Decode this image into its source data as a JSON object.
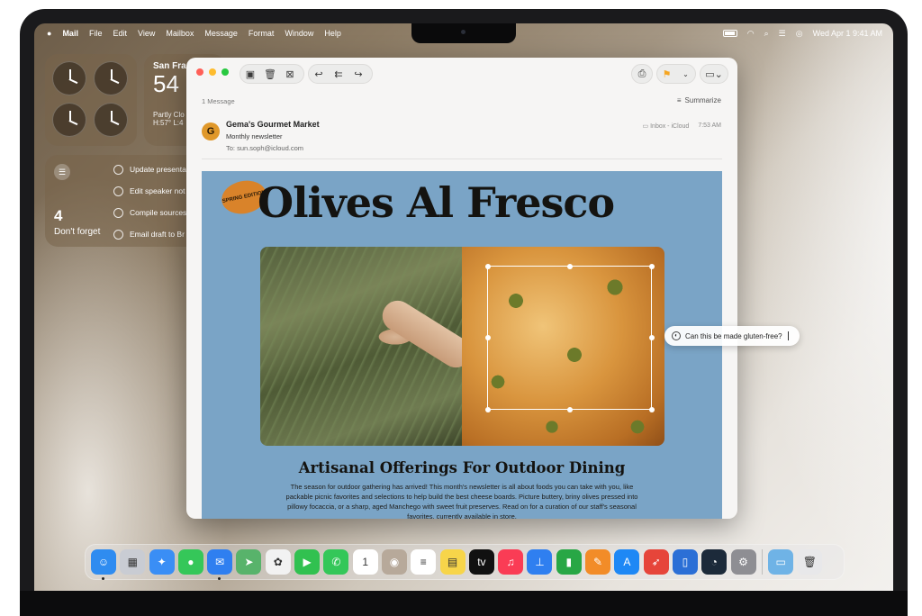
{
  "menubar": {
    "apple": "",
    "app_name": "Mail",
    "menus": [
      "File",
      "Edit",
      "View",
      "Mailbox",
      "Message",
      "Format",
      "Window",
      "Help"
    ],
    "datetime": "Wed Apr 1  9:41 AM"
  },
  "widgets": {
    "weather": {
      "city": "San Fra",
      "temp": "54",
      "condition": "Partly Clo",
      "hilo": "H:57° L:4"
    },
    "reminders": {
      "count": "4",
      "label": "Don't forget",
      "items": [
        "Update presenta",
        "Edit speaker not",
        "Compile sources",
        "Email draft to Br"
      ]
    }
  },
  "mail": {
    "message_count": "1 Message",
    "summarize_label": "Summarize",
    "sender_initial": "G",
    "sender": "Gema's Gourmet Market",
    "subject": "Monthly newsletter",
    "to_label": "To:",
    "to_address": "sun.soph@icloud.com",
    "mailbox": "Inbox - iCloud",
    "time": "7:53 AM"
  },
  "newsletter": {
    "badge": "SPRING EDITION",
    "headline": "Olives Al Fresco",
    "article_title": "Artisanal Offerings For Outdoor Dining",
    "article_body": "The season for outdoor gathering has arrived! This month's newsletter is all about foods you can take with you, like packable picnic favorites and selections to help build the best cheese boards. Picture buttery, briny olives pressed into pillowy focaccia, or a sharp, aged Manchego with sweet fruit preserves. Read on for a curation of our staff's seasonal favorites, currently available in store."
  },
  "query": {
    "text": "Can this be made gluten-free?"
  },
  "dock": {
    "apps": [
      {
        "name": "finder-icon",
        "color": "#2f8cf0",
        "glyph": "☺"
      },
      {
        "name": "launchpad-icon",
        "color": "#c9ccd3",
        "glyph": "▦"
      },
      {
        "name": "safari-icon",
        "color": "#3a8ef5",
        "glyph": "✦"
      },
      {
        "name": "messages-icon",
        "color": "#35c759",
        "glyph": "●"
      },
      {
        "name": "mail-icon",
        "color": "#2f7ff0",
        "glyph": "✉"
      },
      {
        "name": "maps-icon",
        "color": "#58b36b",
        "glyph": "➤"
      },
      {
        "name": "photos-icon",
        "color": "#f2f2f2",
        "glyph": "✿"
      },
      {
        "name": "facetime-icon",
        "color": "#31c150",
        "glyph": "▶"
      },
      {
        "name": "phone-icon",
        "color": "#34c759",
        "glyph": "✆"
      },
      {
        "name": "calendar-icon",
        "color": "#ffffff",
        "glyph": "1"
      },
      {
        "name": "contacts-icon",
        "color": "#b7a99a",
        "glyph": "◉"
      },
      {
        "name": "reminders-icon",
        "color": "#ffffff",
        "glyph": "≡"
      },
      {
        "name": "notes-icon",
        "color": "#f7d54a",
        "glyph": "▤"
      },
      {
        "name": "tv-icon",
        "color": "#111111",
        "glyph": "tv"
      },
      {
        "name": "music-icon",
        "color": "#fa3c55",
        "glyph": "♫"
      },
      {
        "name": "keynote-icon",
        "color": "#2f7ff0",
        "glyph": "⊥"
      },
      {
        "name": "numbers-icon",
        "color": "#28a745",
        "glyph": "▮"
      },
      {
        "name": "pages-icon",
        "color": "#f28c28",
        "glyph": "✎"
      },
      {
        "name": "app-store-icon",
        "color": "#1e88f5",
        "glyph": "A"
      },
      {
        "name": "rocket-icon",
        "color": "#e6453a",
        "glyph": "➶"
      },
      {
        "name": "simulator-icon",
        "color": "#2b6fd6",
        "glyph": "▯"
      },
      {
        "name": "speedometer-icon",
        "color": "#1c2a3a",
        "glyph": "◔"
      },
      {
        "name": "settings-icon",
        "color": "#8e8e93",
        "glyph": "⚙"
      }
    ],
    "extras": [
      {
        "name": "downloads-folder-icon",
        "color": "#6fb3e6",
        "glyph": "▭"
      },
      {
        "name": "trash-icon",
        "color": "#e8e8ea",
        "glyph": "🗑"
      }
    ]
  },
  "colors": {
    "traffic_red": "#ff5f57",
    "traffic_yellow": "#febc2e",
    "traffic_green": "#28c840",
    "newsletter_bg": "#7aa4c6",
    "flag": "#f5a623"
  }
}
